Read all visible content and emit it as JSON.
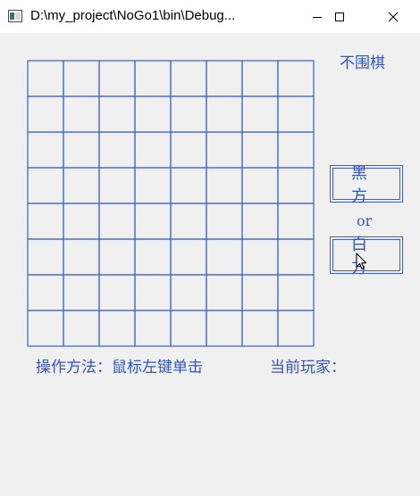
{
  "window": {
    "title": "D:\\my_project\\NoGo1\\bin\\Debug...",
    "controls": {
      "minimize_icon": "minimize-icon",
      "maximize_icon": "maximize-icon",
      "close_icon": "close-icon"
    }
  },
  "game": {
    "title": "不围棋",
    "board": {
      "rows": 8,
      "cols": 8,
      "line_color": "#3b5fd0"
    },
    "black_button_label": "黑方",
    "or_label": "or",
    "white_button_label": "白方",
    "instructions": "操作方法：鼠标左键单击",
    "current_player_label": "当前玩家："
  },
  "colors": {
    "accent": "#2f55c7",
    "background": "#f0f0f0",
    "titlebar": "#ffffff"
  }
}
